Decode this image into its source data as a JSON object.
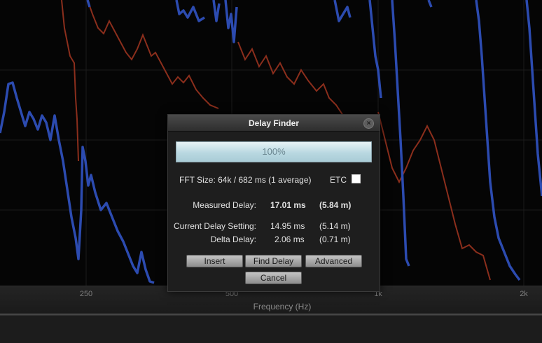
{
  "axis": {
    "ticks": [
      "250",
      "500",
      "1k",
      "2k"
    ],
    "title": "Frequency (Hz)"
  },
  "colors": {
    "blue_trace": "#2c4bb0",
    "red_trace": "#8b2e1c",
    "grid": "#1b1b1b"
  },
  "dialog": {
    "title": "Delay Finder",
    "close_icon": "x-icon",
    "progress": {
      "value": 100,
      "label": "100%"
    },
    "fft_size": "FFT Size: 64k / 682 ms (1 average)",
    "etc_label": "ETC",
    "etc_checked": false,
    "measured": {
      "label": "Measured Delay:",
      "ms": "17.01 ms",
      "m": "(5.84 m)"
    },
    "current": {
      "label": "Current Delay Setting:",
      "ms": "14.95 ms",
      "m": "(5.14 m)"
    },
    "delta": {
      "label": "Delta Delay:",
      "ms": "2.06 ms",
      "m": "(0.71 m)"
    },
    "buttons": {
      "insert": "Insert",
      "find_delay": "Find Delay",
      "advanced": "Advanced",
      "cancel": "Cancel"
    }
  }
}
